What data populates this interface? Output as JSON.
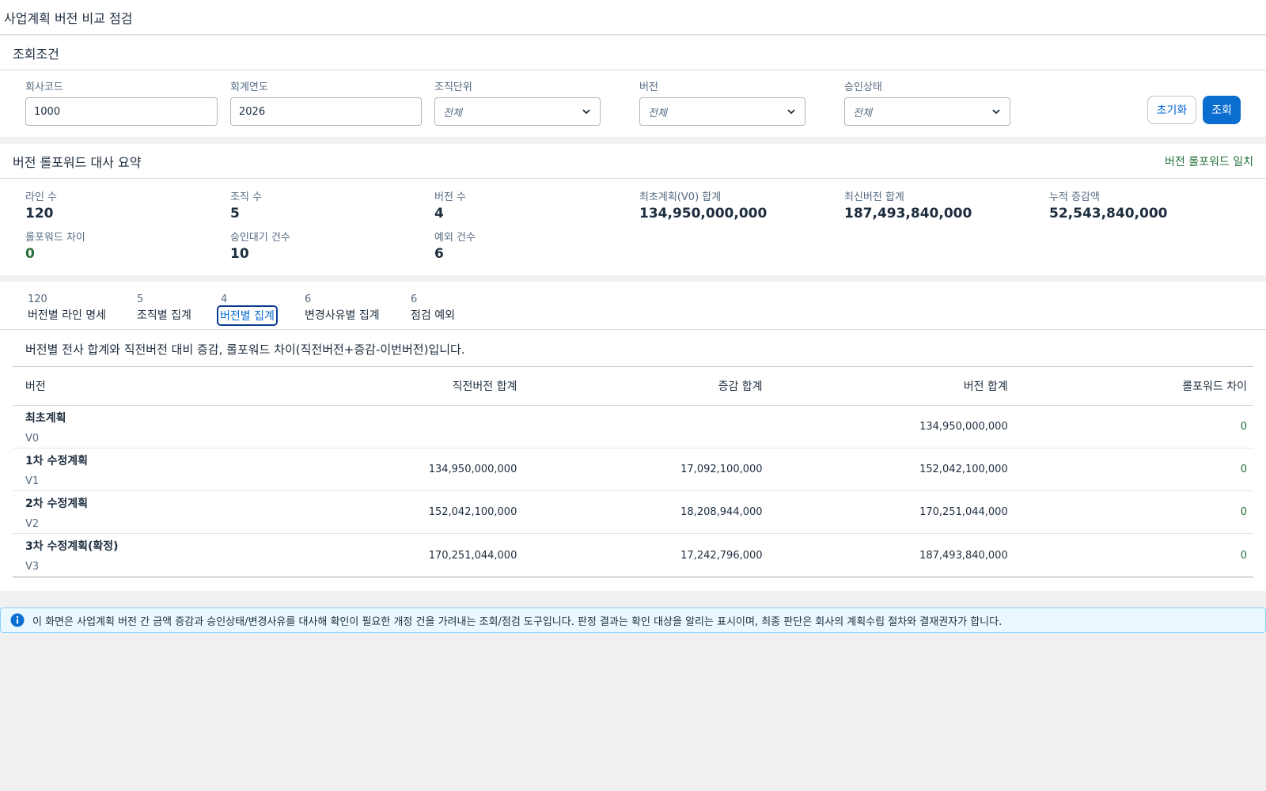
{
  "page": {
    "title": "사업계획 버전 비교 점검"
  },
  "filters": {
    "title": "조회조건",
    "company_code": {
      "label": "회사코드",
      "value": "1000"
    },
    "fiscal_year": {
      "label": "회계연도",
      "value": "2026"
    },
    "org_unit": {
      "label": "조직단위",
      "value": "전체"
    },
    "version": {
      "label": "버전",
      "value": "전체"
    },
    "approval_status": {
      "label": "승인상태",
      "value": "전체"
    },
    "reset_label": "초기화",
    "search_label": "조회"
  },
  "summary": {
    "title": "버전 롤포워드 대사 요약",
    "status": "버전 롤포워드 일치",
    "kpis": {
      "lines": {
        "label": "라인 수",
        "value": "120"
      },
      "orgs": {
        "label": "조직 수",
        "value": "5"
      },
      "versions": {
        "label": "버전 수",
        "value": "4"
      },
      "v0_total": {
        "label": "최초계획(V0) 합계",
        "value": "134,950,000,000"
      },
      "latest_total": {
        "label": "최신버전 합계",
        "value": "187,493,840,000"
      },
      "cumulative": {
        "label": "누적 증감액",
        "value": "52,543,840,000"
      },
      "rollforward_diff": {
        "label": "롤포워드 차이",
        "value": "0"
      },
      "pending": {
        "label": "승인대기 건수",
        "value": "10"
      },
      "exceptions": {
        "label": "예외 건수",
        "value": "6"
      }
    }
  },
  "tabs": [
    {
      "count": "120",
      "label": "버전별 라인 명세"
    },
    {
      "count": "5",
      "label": "조직별 집계"
    },
    {
      "count": "4",
      "label": "버전별 집계"
    },
    {
      "count": "6",
      "label": "변경사유별 집계"
    },
    {
      "count": "6",
      "label": "점검 예외"
    }
  ],
  "main": {
    "description": "버전별 전사 합계와 직전버전 대비 증감, 롤포워드 차이(직전버전+증감-이번버전)입니다.",
    "columns": [
      "버전",
      "직전버전 합계",
      "증감 합계",
      "버전 합계",
      "롤포워드 차이"
    ],
    "rows": [
      {
        "name": "최초계획",
        "code": "V0",
        "prev": "",
        "delta": "",
        "total": "134,950,000,000",
        "diff": "0"
      },
      {
        "name": "1차 수정계획",
        "code": "V1",
        "prev": "134,950,000,000",
        "delta": "17,092,100,000",
        "total": "152,042,100,000",
        "diff": "0"
      },
      {
        "name": "2차 수정계획",
        "code": "V2",
        "prev": "152,042,100,000",
        "delta": "18,208,944,000",
        "total": "170,251,044,000",
        "diff": "0"
      },
      {
        "name": "3차 수정계획(확정)",
        "code": "V3",
        "prev": "170,251,044,000",
        "delta": "17,242,796,000",
        "total": "187,493,840,000",
        "diff": "0"
      }
    ]
  },
  "notice": "이 화면은 사업계획 버전 간 금액 증감과 승인상태/변경사유를 대사해 확인이 필요한 개정 건을 가려내는 조회/점검 도구입니다. 판정 결과는 확인 대상을 알리는 표시이며, 최종 판단은 회사의 계획수립 절차와 결재권자가 합니다.",
  "colors": {
    "accent": "#0a6ed1",
    "success": "#256f3a",
    "info_bg": "#ebf8ff"
  }
}
